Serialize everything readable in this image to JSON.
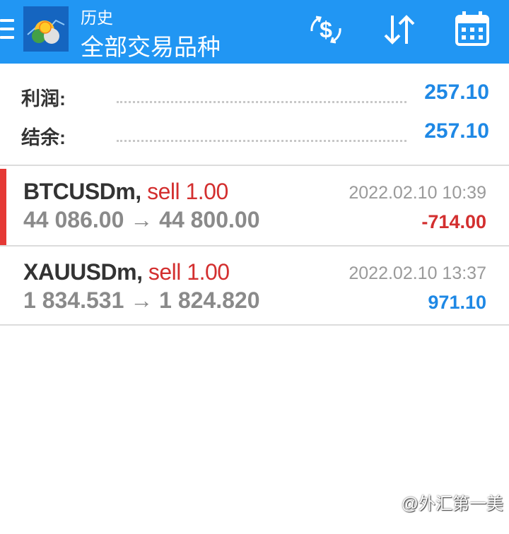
{
  "topbar": {
    "title": "历史",
    "subtitle": "全部交易品种",
    "icons": [
      "menu-icon",
      "app-logo",
      "currency-exchange-icon",
      "sort-icon",
      "calendar-icon"
    ]
  },
  "summary": {
    "profit_label": "利润:",
    "profit_value": "257.10",
    "balance_label": "结余:",
    "balance_value": "257.10"
  },
  "trades": [
    {
      "symbol": "BTCUSDm,",
      "side": "sell 1.00",
      "prices": "44 086.00 → 44 800.00",
      "time": "2022.02.10 10:39",
      "profit": "-714.00",
      "profit_color": "#d32f2f"
    },
    {
      "symbol": "XAUUSDm,",
      "side": "sell 1.00",
      "prices": "1 834.531 → 1 824.820",
      "time": "2022.02.10 13:37",
      "profit": "971.10",
      "profit_color": "#1e88e5"
    }
  ],
  "watermark": "@外汇第一美",
  "colors": {
    "accent": "#2196f3",
    "loss": "#d32f2f",
    "gain": "#1e88e5"
  }
}
